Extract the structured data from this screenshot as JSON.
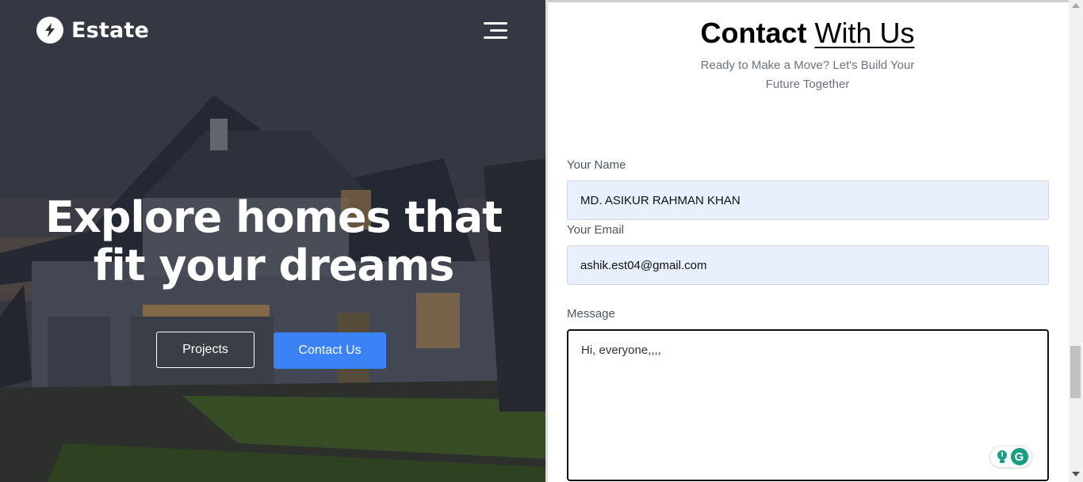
{
  "brand": {
    "name": "Estate",
    "logo_icon": "bolt-icon"
  },
  "nav": {
    "menu_icon": "hamburger-menu-icon"
  },
  "hero": {
    "title_line1": "Explore homes that",
    "title_line2": "fit your dreams",
    "buttons": {
      "projects": "Projects",
      "contact": "Contact Us"
    }
  },
  "contact": {
    "title_strong": "Contact",
    "title_light": "With Us",
    "subtitle_line1": "Ready to Make a Move? Let's Build Your",
    "subtitle_line2": "Future Together",
    "fields": {
      "name": {
        "label": "Your Name",
        "value": "MD. ASIKUR RAHMAN KHAN"
      },
      "email": {
        "label": "Your Email",
        "value": "ashik.est04@gmail.com"
      },
      "message": {
        "label": "Message",
        "value": "Hi, everyone,,,,"
      }
    }
  },
  "colors": {
    "primary": "#3b82f6",
    "input_bg": "#e8f0fe",
    "grammarly": "#15a085"
  }
}
